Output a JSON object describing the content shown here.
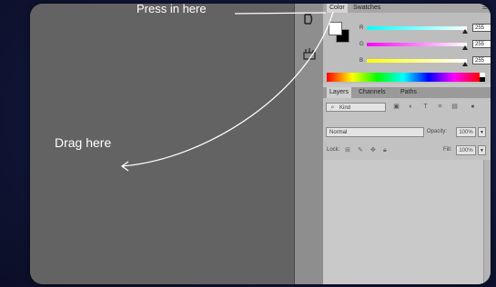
{
  "annotations": {
    "press_text": "Press in here",
    "drag_text": "Drag here"
  },
  "color_panel": {
    "tabs": [
      "Color",
      "Swatches"
    ],
    "menu_icon": "panel-menu-icon",
    "foreground_color": "#ffffff",
    "background_color": "#000000",
    "sliders": [
      {
        "label": "R",
        "value": "255"
      },
      {
        "label": "G",
        "value": "255"
      },
      {
        "label": "B",
        "value": "255"
      }
    ]
  },
  "layers_panel": {
    "tabs": [
      "Layers",
      "Channels",
      "Paths"
    ],
    "kind_filter": "Kind",
    "blend_mode": "Normal",
    "opacity_label": "Opacity:",
    "opacity_value": "100%",
    "lock_label": "Lock:",
    "fill_label": "Fill:",
    "fill_value": "100%"
  },
  "toolstrip": {
    "icons": [
      "history-brush-icon",
      "adjustments-icon"
    ]
  },
  "colors": {
    "canvas": "#636363",
    "panel": "#c6c6c6",
    "annotation": "#ffffff"
  }
}
